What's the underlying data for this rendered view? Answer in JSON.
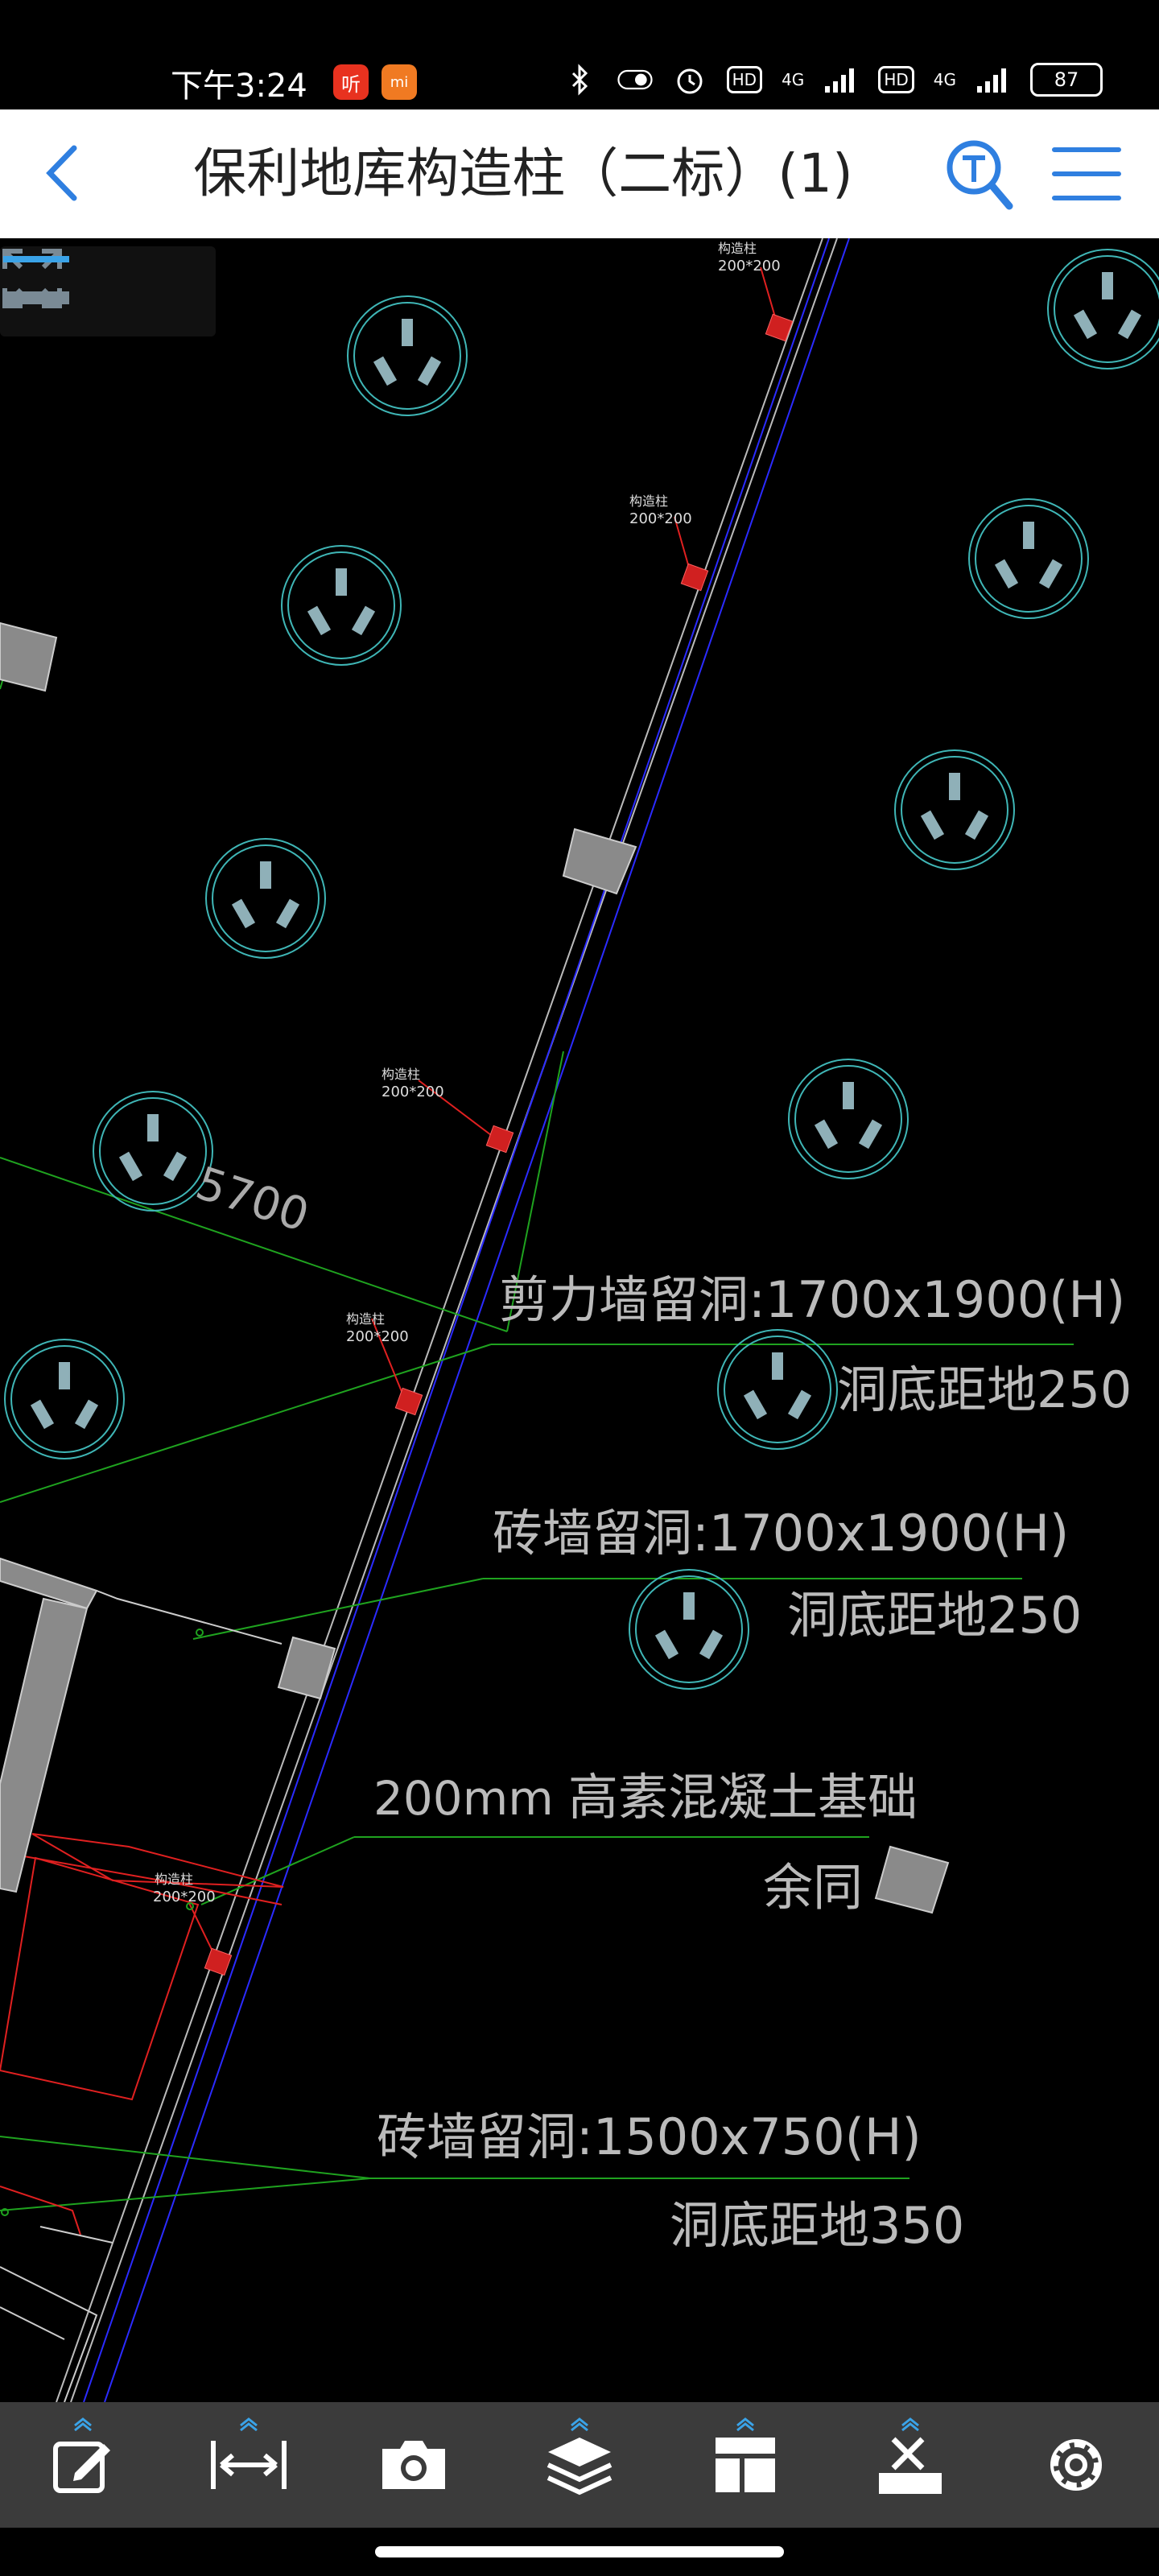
{
  "status": {
    "time": "下午3:24",
    "badge1": "听",
    "badge2": "mi",
    "hd1": "HD",
    "net1": "4G",
    "hd2": "HD",
    "net2": "4G",
    "battery": "87"
  },
  "header": {
    "title": "保利地库构造柱（二标）(1)"
  },
  "drawing": {
    "col_label": "构造柱",
    "col_size": "200*200",
    "dim_5700": "5700",
    "shear_hole": "剪力墙留洞:1700x1900(H)",
    "shear_hole_bottom": "洞底距地250",
    "brick_hole": "砖墙留洞:1700x1900(H)",
    "brick_hole_bottom": "洞底距地250",
    "thickness": "200mm",
    "foundation": "高素混凝土基础",
    "same": "余同",
    "brick_hole2": "砖墙留洞:1500x750(H)",
    "brick_hole2_bottom": "洞底距地350"
  },
  "toolbar": {
    "items": [
      "edit-icon",
      "measure-icon",
      "camera-icon",
      "layers-icon",
      "layout-icon",
      "toolbox-icon",
      "settings-icon"
    ]
  },
  "colors": {
    "accent": "#2f7fe0",
    "cad_green": "#1fa31f",
    "cad_red": "#e02020",
    "cad_blue": "#3a3aff",
    "socket_cyan": "#3fb6b6"
  }
}
